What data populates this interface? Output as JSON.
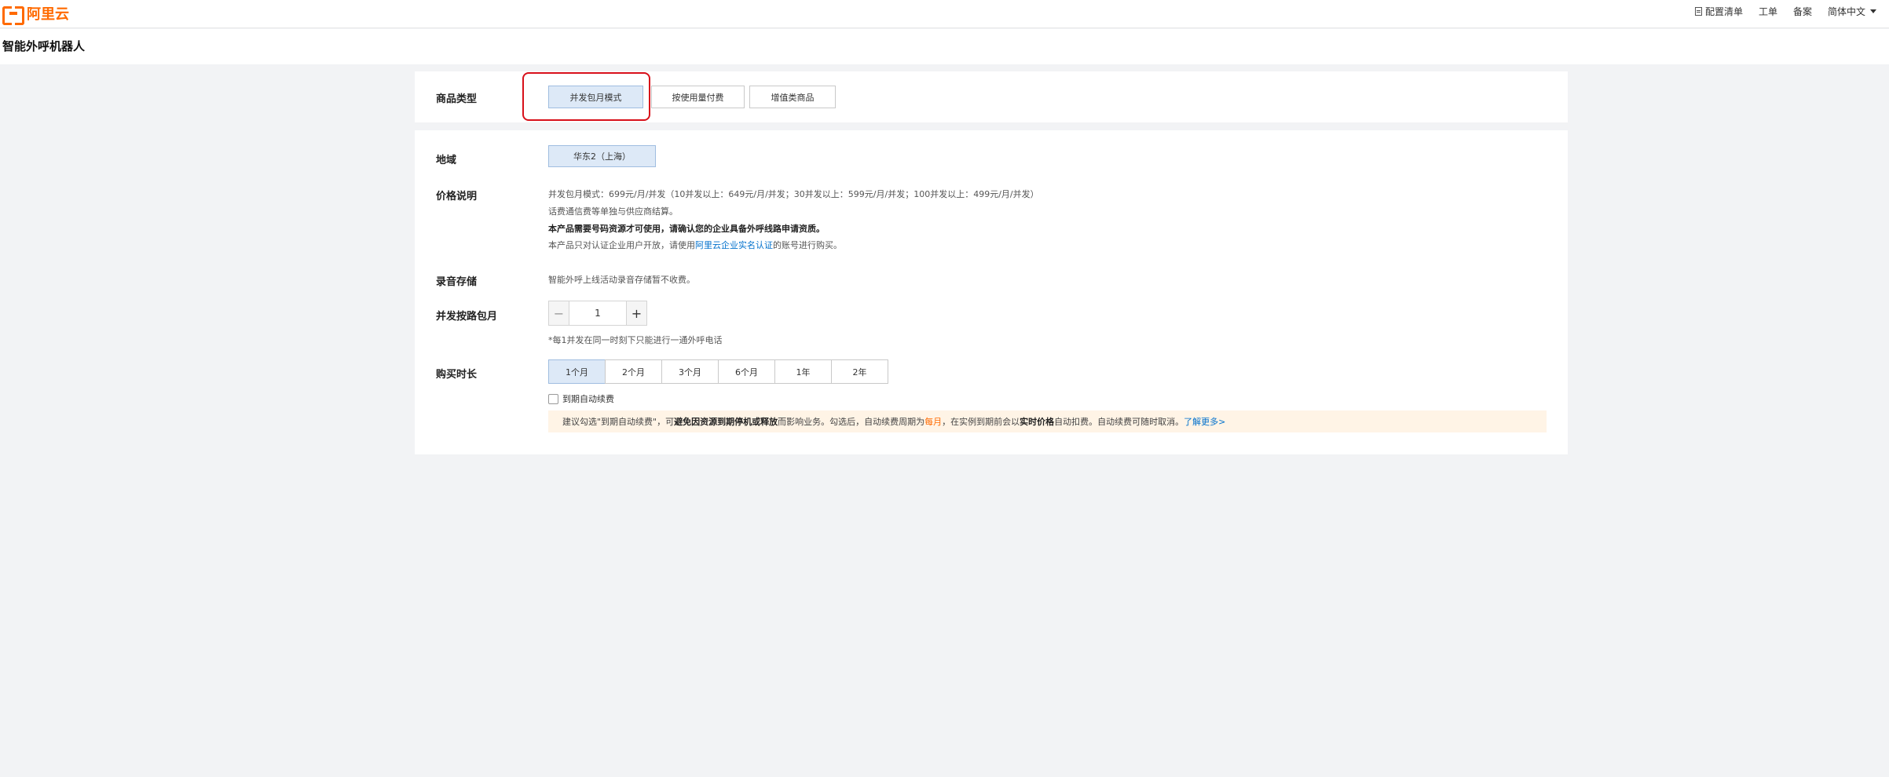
{
  "header": {
    "logo_text": "阿里云",
    "nav": {
      "config_list": "配置清单",
      "ticket": "工单",
      "filing": "备案",
      "language": "简体中文"
    }
  },
  "page_title": "智能外呼机器人",
  "product_type": {
    "label": "商品类型",
    "options": [
      "并发包月模式",
      "按使用量付费",
      "增值类商品"
    ],
    "selected_index": 0
  },
  "region": {
    "label": "地域",
    "value": "华东2（上海）"
  },
  "price": {
    "label": "价格说明",
    "line1": "并发包月模式：699元/月/并发（10并发以上：649元/月/并发；30并发以上：599元/月/并发；100并发以上：499元/月/并发）",
    "line2": "话费通信费等单独与供应商结算。",
    "line3": "本产品需要号码资源才可使用，请确认您的企业具备外呼线路申请资质。",
    "line4_prefix": "本产品只对认证企业用户开放，请使用",
    "line4_link": "阿里云企业实名认证",
    "line4_suffix": "的账号进行购买。"
  },
  "recording": {
    "label": "录音存储",
    "text": "智能外呼上线活动录音存储暂不收费。"
  },
  "concurrency": {
    "label": "并发按路包月",
    "minus": "−",
    "value": "1",
    "plus": "+",
    "hint": "*每1并发在同一时刻下只能进行一通外呼电话"
  },
  "duration": {
    "label": "购买时长",
    "options": [
      "1个月",
      "2个月",
      "3个月",
      "6个月",
      "1年",
      "2年"
    ],
    "selected_index": 0
  },
  "auto_renew": {
    "label": "到期自动续费",
    "checked": false
  },
  "notice": {
    "p1": "建议勾选\"到期自动续费\"，可",
    "b1": "避免因资源到期停机或释放",
    "p2": "而影响业务。勾选后，自动续费周期为 ",
    "orange": "每月",
    "p3": "，在实例到期前会以",
    "b2": "实时价格",
    "p4": "自动扣费。自动续费可随时取消。",
    "link": "了解更多>"
  },
  "colors": {
    "brand": "#ff6a00",
    "selected_bg": "#dde9f7",
    "link": "#0070cc",
    "highlight": "#d8101a",
    "notice_bg": "#fff4e6"
  }
}
